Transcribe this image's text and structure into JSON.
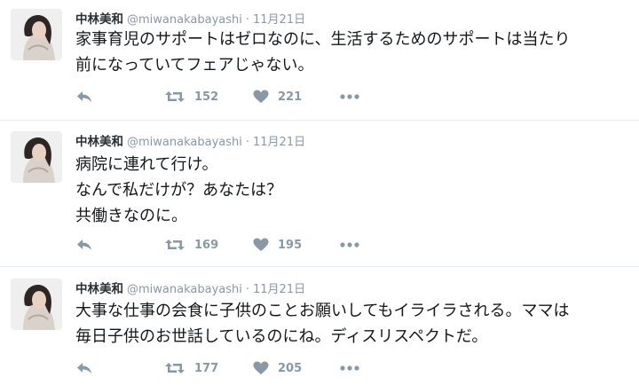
{
  "colors": {
    "icon": "#8899a6",
    "name": "#292f33",
    "meta": "#8899a6",
    "divider": "#e6ecf0"
  },
  "icons": {
    "reply": "reply-icon",
    "retweet": "retweet-icon",
    "like": "heart-icon",
    "more": "more-icon"
  },
  "tweets": [
    {
      "name": "中林美和",
      "handle": "@miwanakabayashi",
      "dot": "·",
      "time": "11月21日",
      "lines": [
        "家事育児のサポートはゼロなのに、生活するためのサポートは当たり",
        "前になっていてフェアじゃない。"
      ],
      "retweets": "152",
      "likes": "221"
    },
    {
      "name": "中林美和",
      "handle": "@miwanakabayashi",
      "dot": "·",
      "time": "11月21日",
      "lines": [
        "病院に連れて行け。",
        "なんで私だけが？あなたは？",
        "共働きなのに。"
      ],
      "retweets": "169",
      "likes": "195"
    },
    {
      "name": "中林美和",
      "handle": "@miwanakabayashi",
      "dot": "·",
      "time": "11月21日",
      "lines": [
        "大事な仕事の会食に子供のことお願いしてもイライラされる。ママは",
        "毎日子供のお世話しているのにね。ディスリスペクトだ。"
      ],
      "retweets": "177",
      "likes": "205"
    }
  ]
}
